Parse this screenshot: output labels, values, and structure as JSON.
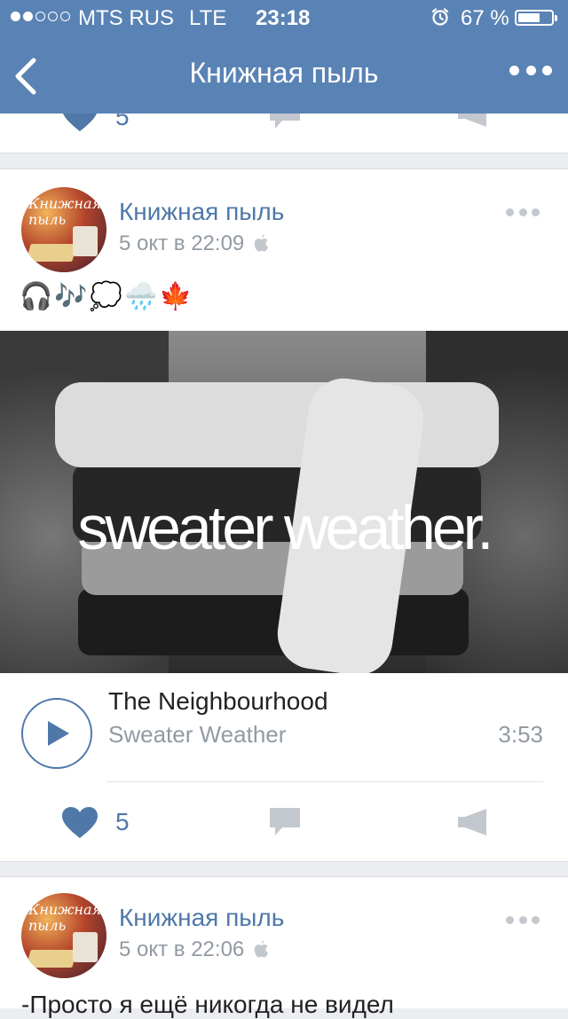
{
  "status_bar": {
    "carrier": "MTS RUS",
    "network": "LTE",
    "time": "23:18",
    "battery_percent": "67 %",
    "battery_level": 0.67,
    "signal_bars_filled": 2,
    "signal_bars_total": 5
  },
  "nav": {
    "back_icon": "chevron-left-icon",
    "title": "Книжная пыль",
    "more_icon": "more-dots-icon"
  },
  "prev_post": {
    "like_count": "5"
  },
  "post1": {
    "author": "Книжная пыль",
    "avatar_text": "Книжная пыль",
    "date": "5 окт в 22:09",
    "emojis": "🎧🎶💭🌧️🍁",
    "image_caption": "sweater weather.",
    "audio": {
      "artist": "The Neighbourhood",
      "title": "Sweater Weather",
      "duration": "3:53"
    },
    "like_count": "5"
  },
  "post2": {
    "author": "Книжная пыль",
    "avatar_text": "Книжная пыль",
    "date": "5 окт в 22:06",
    "text": "-Просто я ещё никогда не видел"
  },
  "colors": {
    "header": "#5a83b5",
    "accent": "#4f78a9",
    "muted": "#929aa3",
    "icon_gray": "#c3c8ce",
    "background": "#ebedf0"
  }
}
